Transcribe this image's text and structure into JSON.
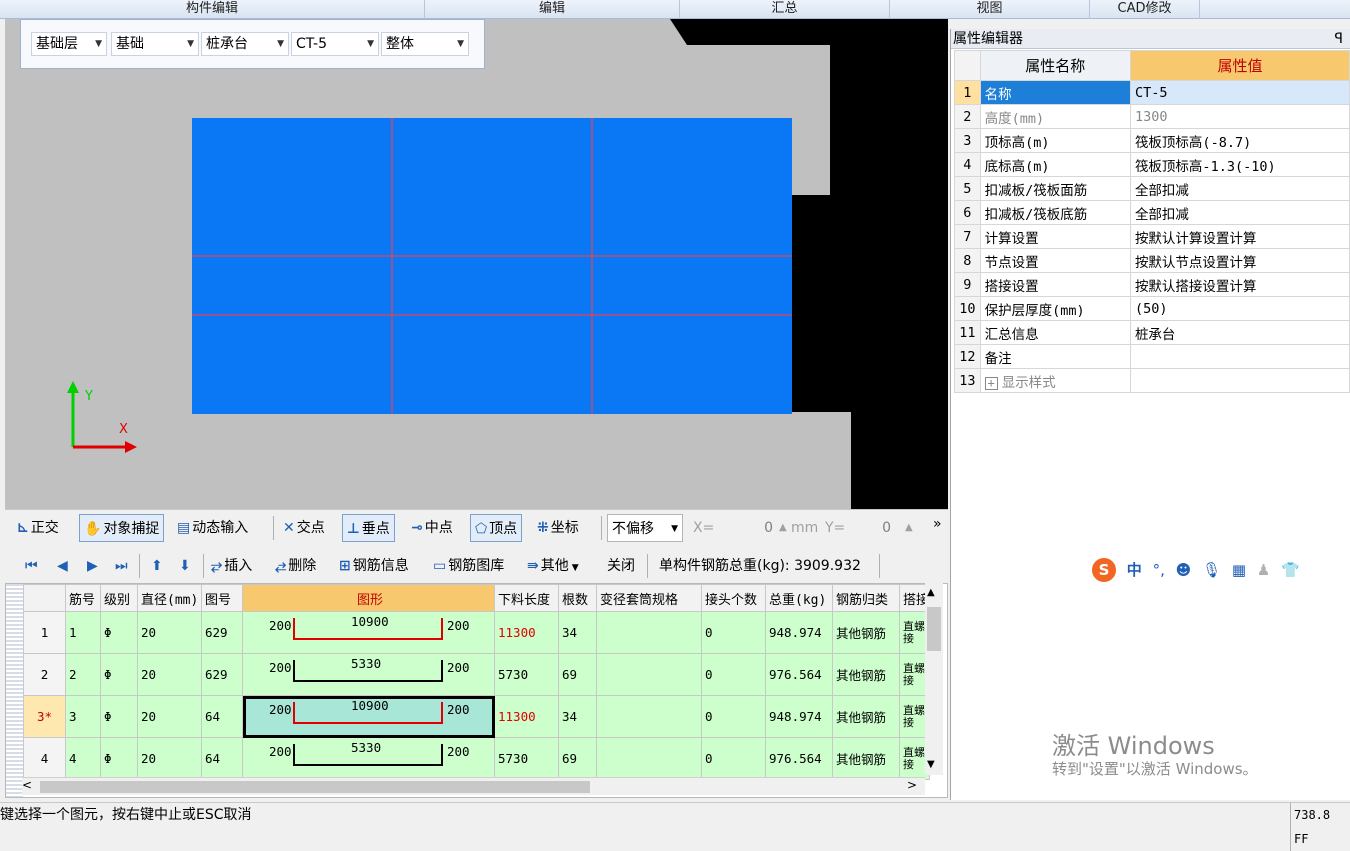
{
  "menu": {
    "items": [
      "构件编辑",
      "编辑",
      "汇总",
      "视图",
      "CAD修改"
    ]
  },
  "component_bar": {
    "floor": "基础层",
    "category": "基础",
    "type": "桩承台",
    "component": "CT-5",
    "scope": "整体"
  },
  "viewport": {
    "axis_x": "X",
    "axis_y": "Y",
    "colors": {
      "background": "#000000",
      "slab": "#0a78f5",
      "gray": "#c0c0c0",
      "lines": "#c8486e"
    }
  },
  "snap_toolbar": {
    "ortho": "正交",
    "object_snap": "对象捕捉",
    "dynamic_input": "动态输入",
    "intersection": "交点",
    "perpendicular": "垂点",
    "midpoint": "中点",
    "vertex": "顶点",
    "coordinate": "坐标",
    "offset_mode": "不偏移",
    "x_label": "X=",
    "x_value": "0",
    "unit": "mm",
    "y_label": "Y=",
    "y_value": "0",
    "more": "»"
  },
  "rebar_toolbar": {
    "insert": "插入",
    "delete": "删除",
    "rebar_info": "钢筋信息",
    "rebar_library": "钢筋图库",
    "other": "其他",
    "close": "关闭",
    "total_weight": "单构件钢筋总重(kg): 3909.932"
  },
  "rebar_grid": {
    "headers": [
      "筋号",
      "级别",
      "直径(mm)",
      "图号",
      "图形",
      "下料长度",
      "根数",
      "变径套筒规格",
      "接头个数",
      "总重(kg)",
      "钢筋归类",
      "搭接"
    ],
    "rows": [
      {
        "rownum": "1",
        "no": "1",
        "grade": "Φ",
        "dia": "20",
        "fig": "629",
        "left": "200",
        "mid": "10900",
        "right": "200",
        "cut": "11300",
        "count": "34",
        "sleeve": "",
        "joints": "0",
        "weight": "948.974",
        "cat": "其他钢筋",
        "lap": "直螺接",
        "style": "red"
      },
      {
        "rownum": "2",
        "no": "2",
        "grade": "Φ",
        "dia": "20",
        "fig": "629",
        "left": "200",
        "mid": "5330",
        "right": "200",
        "cut": "5730",
        "count": "69",
        "sleeve": "",
        "joints": "0",
        "weight": "976.564",
        "cat": "其他钢筋",
        "lap": "直螺接",
        "style": "black"
      },
      {
        "rownum": "3*",
        "no": "3",
        "grade": "Φ",
        "dia": "20",
        "fig": "64",
        "left": "200",
        "mid": "10900",
        "right": "200",
        "cut": "11300",
        "count": "34",
        "sleeve": "",
        "joints": "0",
        "weight": "948.974",
        "cat": "其他钢筋",
        "lap": "直螺接",
        "style": "red"
      },
      {
        "rownum": "4",
        "no": "4",
        "grade": "Φ",
        "dia": "20",
        "fig": "64",
        "left": "200",
        "mid": "5330",
        "right": "200",
        "cut": "5730",
        "count": "69",
        "sleeve": "",
        "joints": "0",
        "weight": "976.564",
        "cat": "其他钢筋",
        "lap": "直螺接",
        "style": "black"
      }
    ]
  },
  "property_editor": {
    "title": "属性编辑器",
    "pin": "ꟼ",
    "col_name": "属性名称",
    "col_value": "属性值",
    "rows": [
      {
        "n": "1",
        "name": "名称",
        "value": "CT-5"
      },
      {
        "n": "2",
        "name": "高度(mm)",
        "value": "1300"
      },
      {
        "n": "3",
        "name": "顶标高(m)",
        "value": "筏板顶标高(-8.7)"
      },
      {
        "n": "4",
        "name": "底标高(m)",
        "value": "筏板顶标高-1.3(-10)"
      },
      {
        "n": "5",
        "name": "扣减板/筏板面筋",
        "value": "全部扣减"
      },
      {
        "n": "6",
        "name": "扣减板/筏板底筋",
        "value": "全部扣减"
      },
      {
        "n": "7",
        "name": "计算设置",
        "value": "按默认计算设置计算"
      },
      {
        "n": "8",
        "name": "节点设置",
        "value": "按默认节点设置计算"
      },
      {
        "n": "9",
        "name": "搭接设置",
        "value": "按默认搭接设置计算"
      },
      {
        "n": "10",
        "name": "保护层厚度(mm)",
        "value": "(50)"
      },
      {
        "n": "11",
        "name": "汇总信息",
        "value": "桩承台"
      },
      {
        "n": "12",
        "name": "备注",
        "value": ""
      },
      {
        "n": "13",
        "name": "显示样式",
        "value": ""
      }
    ]
  },
  "ime": {
    "label": "中"
  },
  "watermark": {
    "line1": "激活 Windows",
    "line2": "转到\"设置\"以激活 Windows。"
  },
  "status": {
    "message": "键选择一个图元，按右键中止或ESC取消",
    "coord": "738.8 FF"
  }
}
